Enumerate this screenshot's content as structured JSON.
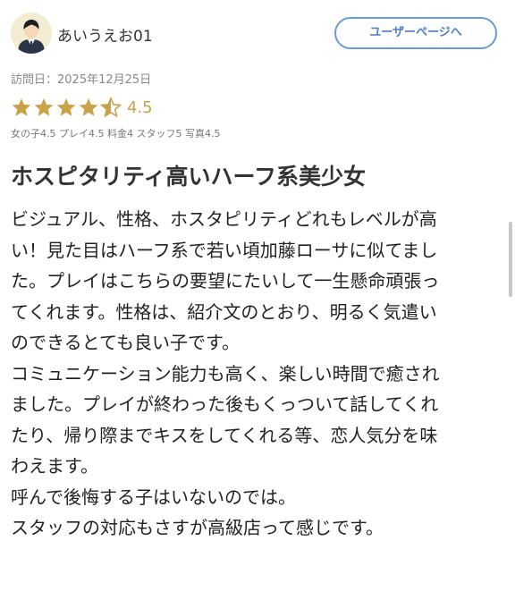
{
  "user": {
    "name": "あいうえお01",
    "page_button": "ユーザーページへ",
    "avatar_icon": "user-avatar-icon"
  },
  "review": {
    "visit_date": "訪問日：2025年12月25日",
    "rating": {
      "value": "4.5",
      "stars": 4.5,
      "max": 5,
      "star_color": "#c9a24a"
    },
    "sub_scores": "女の子4.5 プレイ4.5 料金4 スタッフ5 写真4.5",
    "title": "ホスピタリティ高いハーフ系美少女",
    "body_lines": [
      "ビジュアル、性格、ホスタピリティどれもレベルが高",
      "い！見た目はハーフ系で若い頃加藤ローサに似てまし",
      "た。プレイはこちらの要望にたいして一生懸命頑張っ",
      "てくれます。性格は、紹介文のとおり、明るく気遣い",
      "のできるとても良い子です。",
      "コミュニケーション能力も高く、楽しい時間で癒され",
      "ました。プレイが終わった後もくっついて話してくれ",
      "たり、帰り際までキスをしてくれる等、恋人気分を味",
      "わえます。",
      "呼んで後悔する子はいないのでは。",
      "スタッフの対応もさすが高級店って感じです。"
    ]
  },
  "colors": {
    "accent_blue": "#4d7fc1",
    "star_gold": "#c9a24a"
  }
}
